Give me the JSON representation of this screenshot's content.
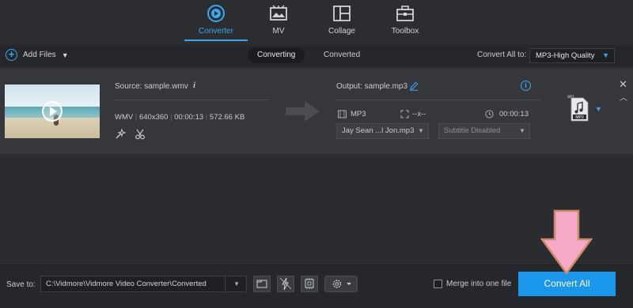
{
  "nav": {
    "tabs": [
      {
        "label": "Converter",
        "icon": "converter-icon",
        "active": true
      },
      {
        "label": "MV",
        "icon": "mv-icon",
        "active": false
      },
      {
        "label": "Collage",
        "icon": "collage-icon",
        "active": false
      },
      {
        "label": "Toolbox",
        "icon": "toolbox-icon",
        "active": false
      }
    ],
    "accent": "#3ea6f0"
  },
  "toolbar": {
    "add_files_label": "Add Files",
    "subtabs": [
      {
        "label": "Converting",
        "active": true
      },
      {
        "label": "Converted",
        "active": false
      }
    ],
    "convert_all_to_label": "Convert All to:",
    "convert_all_to_value": "MP3-High Quality"
  },
  "file": {
    "source_label": "Source: sample.wmv",
    "format": "WMV",
    "resolution": "640x360",
    "duration": "00:00:13",
    "size": "572.66 KB",
    "meta_sep": "|",
    "output_label": "Output: sample.mp3",
    "output_format": "MP3",
    "output_resolution": "--x--",
    "output_duration": "00:00:13",
    "audio_track": "Jay Sean ...l Jon.mp3",
    "subtitle": "Subtitle Disabled",
    "format_badge": "MP3"
  },
  "bottom": {
    "save_to_label": "Save to:",
    "save_path": "C:\\Vidmore\\Vidmore Video Converter\\Converted",
    "merge_label": "Merge into one file",
    "convert_all_label": "Convert All",
    "convert_color": "#1a96ed"
  },
  "annotation": {
    "arrow_color": "#f7a9c8",
    "arrow_outline": "#c98a6a"
  }
}
